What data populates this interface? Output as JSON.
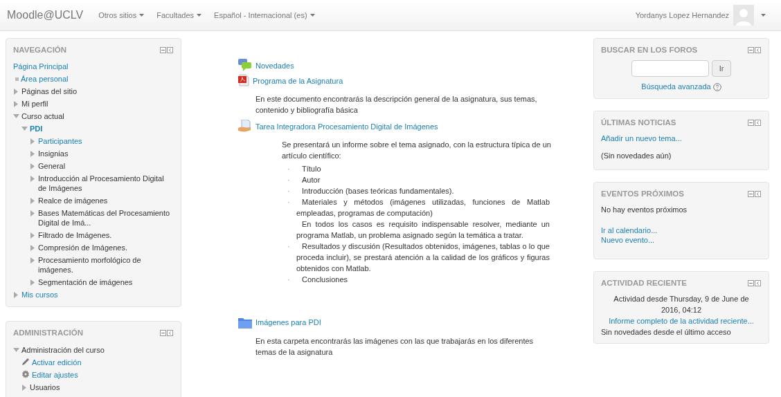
{
  "navbar": {
    "brand": "Moodle@UCLV",
    "menus": [
      {
        "label": "Otros sitios"
      },
      {
        "label": "Facultades"
      },
      {
        "label": "Español - Internacional (es)"
      }
    ],
    "user": "Yordanys Lopez Hernandez"
  },
  "navigation": {
    "title": "NAVEGACIÓN",
    "items": [
      {
        "label": "Página Principal",
        "kind": "home-link"
      },
      {
        "label": "Área personal",
        "kind": "leaf-link"
      },
      {
        "label": "Páginas del sitio",
        "kind": "branch",
        "expanded": false
      },
      {
        "label": "Mi perfil",
        "kind": "branch",
        "expanded": false
      },
      {
        "label": "Curso actual",
        "kind": "branch",
        "expanded": true,
        "children": [
          {
            "label": "PDI",
            "kind": "course",
            "expanded": true,
            "children": [
              {
                "label": "Participantes",
                "kind": "branch-link",
                "expanded": false
              },
              {
                "label": "Insignias",
                "kind": "branch",
                "expanded": false
              },
              {
                "label": "General",
                "kind": "branch",
                "expanded": false
              },
              {
                "label": "Introducción al Procesamiento Digital de Imágenes",
                "kind": "branch",
                "expanded": false
              },
              {
                "label": "Realce de imágenes",
                "kind": "branch",
                "expanded": false
              },
              {
                "label": "Bases Matemáticas del Procesamiento Digital de Imá...",
                "kind": "branch",
                "expanded": false
              },
              {
                "label": "Filtrado de Imágenes.",
                "kind": "branch",
                "expanded": false
              },
              {
                "label": "Compresión de Imágenes.",
                "kind": "branch",
                "expanded": false
              },
              {
                "label": "Procesamiento morfológico de imágenes.",
                "kind": "branch",
                "expanded": false
              },
              {
                "label": "Segmentación de imágenes",
                "kind": "branch",
                "expanded": false
              }
            ]
          }
        ]
      },
      {
        "label": "Mis cursos",
        "kind": "branch-link",
        "expanded": false
      }
    ]
  },
  "administration": {
    "title": "ADMINISTRACIÓN",
    "items": [
      {
        "label": "Administración del curso",
        "kind": "branch",
        "expanded": true,
        "children": [
          {
            "label": "Activar edición",
            "kind": "action"
          },
          {
            "label": "Editar ajustes",
            "kind": "action"
          },
          {
            "label": "Usuarios",
            "kind": "branch",
            "expanded": false
          }
        ]
      }
    ]
  },
  "sections": [
    {
      "kind": "forum",
      "title": "Novedades"
    },
    {
      "kind": "pdf",
      "title": "Programa de la Asignatura",
      "description": "En este documento encontrarás la descripción general de la asignatura, sus temas, contenido y bibliografía básica"
    },
    {
      "kind": "assignment",
      "title": "Tarea Integradora Procesamiento Digital de Imágenes",
      "intro": "Se presentará un informe sobre el tema asignado, con la estructura típica de un artículo científico:",
      "list": [
        {
          "bullet": "·",
          "paragraphs": [
            "Título"
          ]
        },
        {
          "bullet": "·",
          "paragraphs": [
            "Autor"
          ]
        },
        {
          "bullet": "·",
          "paragraphs": [
            "Introducción (bases teóricas fundamentales)."
          ]
        },
        {
          "bullet": "·",
          "paragraphs": [
            "Materiales y métodos (imágenes utilizadas, funciones de Matlab empleadas, programas de computación)",
            "En todos los casos es requisito indispensable resolver, mediante un programa Matlab, un problema asignado según la temática a tratar."
          ]
        },
        {
          "bullet": "·",
          "paragraphs": [
            "Resultados y discusión (Resultados obtenidos, imágenes, tablas o lo que proceda incluir), se prestará atención a la calidad de los gráficos y figuras obtenidos con Matlab."
          ]
        },
        {
          "bullet": "·",
          "paragraphs": [
            "Conclusiones"
          ]
        }
      ]
    },
    {
      "kind": "folder",
      "title": "Imágenes para PDI",
      "description": "En esta carpeta encontrarás las imágenes con las que trabajarás en los diferentes temas de la asignatura"
    }
  ],
  "forum_search": {
    "title": "BUSCAR EN LOS FOROS",
    "button": "Ir",
    "advanced": "Búsqueda avanzada"
  },
  "latest_news": {
    "title": "ÚLTIMAS NOTICIAS",
    "add": "Añadir un nuevo tema...",
    "empty": "(Sin novedades aún)"
  },
  "upcoming_events": {
    "title": "EVENTOS PRÓXIMOS",
    "empty": "No hay eventos próximos",
    "links": [
      "Ir al calendario...",
      "Nuevo evento..."
    ]
  },
  "recent_activity": {
    "title": "ACTIVIDAD RECIENTE",
    "since": "Actividad desde Thursday, 9 de June de 2016, 04:12",
    "report": "Informe completo de la actividad reciente...",
    "empty": "Sin novedades desde el último acceso"
  }
}
